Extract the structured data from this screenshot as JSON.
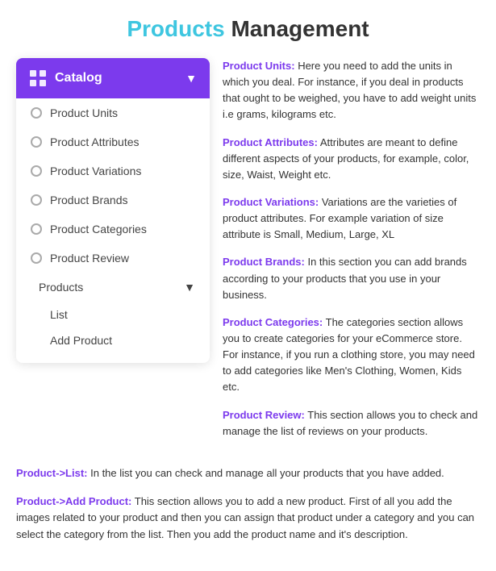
{
  "header": {
    "title_highlight": "Products",
    "title_rest": " Management"
  },
  "sidebar": {
    "catalog_label": "Catalog",
    "items": [
      {
        "id": "product-units",
        "label": "Product Units"
      },
      {
        "id": "product-attributes",
        "label": "Product Attributes"
      },
      {
        "id": "product-variations",
        "label": "Product Variations"
      },
      {
        "id": "product-brands",
        "label": "Product Brands"
      },
      {
        "id": "product-categories",
        "label": "Product Categories"
      },
      {
        "id": "product-review",
        "label": "Product Review"
      }
    ],
    "products_label": "Products",
    "products_sub": [
      {
        "id": "list",
        "label": "List"
      },
      {
        "id": "add-product",
        "label": "Add Product"
      }
    ]
  },
  "descriptions": [
    {
      "id": "product-units",
      "label": "Product Units:",
      "text": " Here you need to add the units in which you deal. For instance, if you deal in products that ought to be weighed, you have to add weight units i.e grams, kilograms etc."
    },
    {
      "id": "product-attributes",
      "label": "Product Attributes:",
      "text": " Attributes are meant to define different aspects of your products, for example, color, size, Waist, Weight etc."
    },
    {
      "id": "product-variations",
      "label": "Product Variations:",
      "text": " Variations are the varieties of product attributes. For example variation of size attribute is Small, Medium, Large, XL"
    },
    {
      "id": "product-brands",
      "label": "Product Brands:",
      "text": " In this section you can add brands according to your products that you use in your business."
    },
    {
      "id": "product-categories",
      "label": "Product Categories:",
      "text": " The categories section allows you to create categories for your eCommerce store. For instance, if you run a clothing store, you may need to add categories like Men's Clothing, Women, Kids etc."
    },
    {
      "id": "product-review",
      "label": "Product Review:",
      "text": " This section allows you to check and manage the list of reviews on your products."
    }
  ],
  "bottom_descriptions": [
    {
      "id": "product-list",
      "label": "Product->List:",
      "text": " In the list you can check and manage all your products that you have added."
    },
    {
      "id": "product-add",
      "label": "Product->Add Product:",
      "text": " This section allows you to add a new product. First of all you add the images related to your product and then you can assign that product under a category and you can select the category from the list. Then you add the product name and it's description."
    }
  ]
}
